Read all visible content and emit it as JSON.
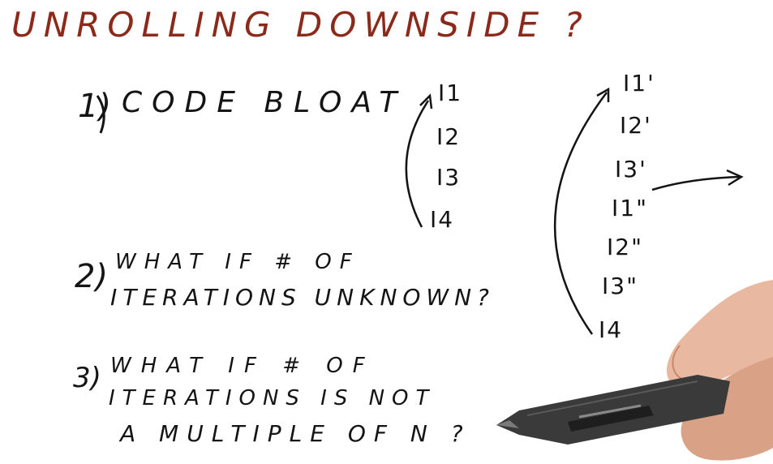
{
  "title": "UNROLLING DOWNSIDE ?",
  "points": [
    {
      "number": "1)",
      "lines": [
        "CODE BLOAT"
      ]
    },
    {
      "number": "2)",
      "lines": [
        "WHAT IF # OF",
        "ITERATIONS UNKNOWN?"
      ]
    },
    {
      "number": "3)",
      "lines": [
        "WHAT IF # OF",
        "ITERATIONS IS NOT",
        "A MULTIPLE OF N ?"
      ]
    }
  ],
  "loop_original": [
    "I1",
    "I2",
    "I3",
    "I4"
  ],
  "loop_unrolled": [
    "I1'",
    "I2'",
    "I3'",
    "I1\"",
    "I2\"",
    "I3\"",
    "I4"
  ],
  "colors": {
    "title": "#8b2a1a",
    "ink": "#141414"
  }
}
